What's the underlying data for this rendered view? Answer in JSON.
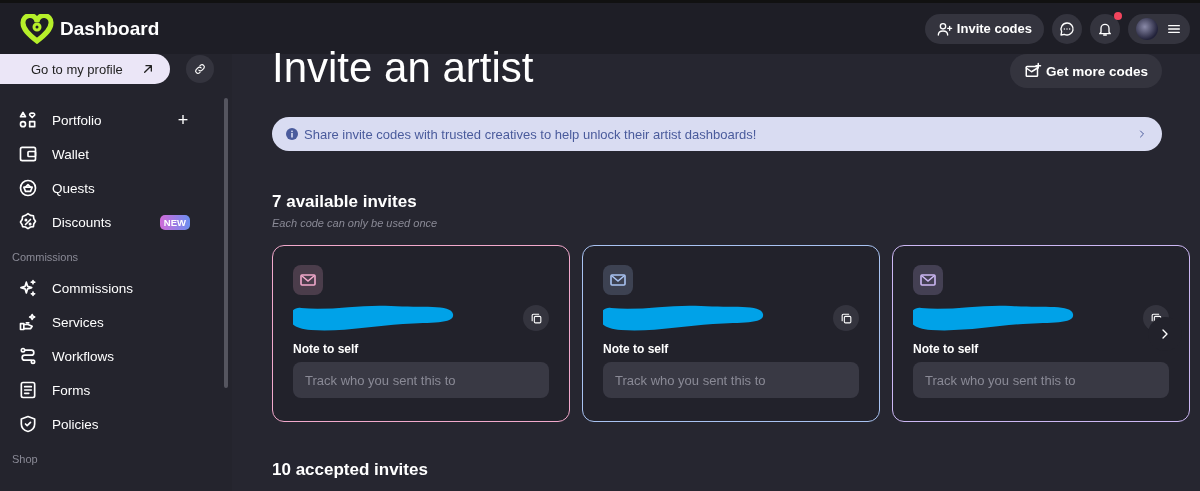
{
  "header": {
    "title": "Dashboard",
    "invite_button": "Invite codes",
    "has_unread": true
  },
  "sidebar": {
    "profile_button": "Go to my profile",
    "sections": [
      {
        "items": [
          {
            "label": "Portfolio",
            "action": "+"
          },
          {
            "label": "Wallet"
          },
          {
            "label": "Quests"
          },
          {
            "label": "Discounts",
            "badge": "NEW"
          }
        ]
      },
      {
        "heading": "Commissions",
        "items": [
          {
            "label": "Commissions"
          },
          {
            "label": "Services"
          },
          {
            "label": "Workflows"
          },
          {
            "label": "Forms"
          },
          {
            "label": "Policies"
          }
        ]
      },
      {
        "heading": "Shop"
      }
    ]
  },
  "page": {
    "title": "Invite an artist",
    "action": "Get more codes",
    "banner": "Share invite codes with trusted creatives to help unlock their artist dashboards!",
    "available": {
      "heading": "7 available invites",
      "note": "Each code can only be used once",
      "cards": [
        {
          "color": "#f2a9cc",
          "note_label": "Note to self",
          "placeholder": "Track who you sent this to"
        },
        {
          "color": "#a9c3f2",
          "note_label": "Note to self",
          "placeholder": "Track who you sent this to"
        },
        {
          "color": "#cdb8f4",
          "note_label": "Note to self",
          "placeholder": "Track who you sent this to"
        }
      ]
    },
    "accepted": {
      "heading": "10 accepted invites"
    }
  }
}
